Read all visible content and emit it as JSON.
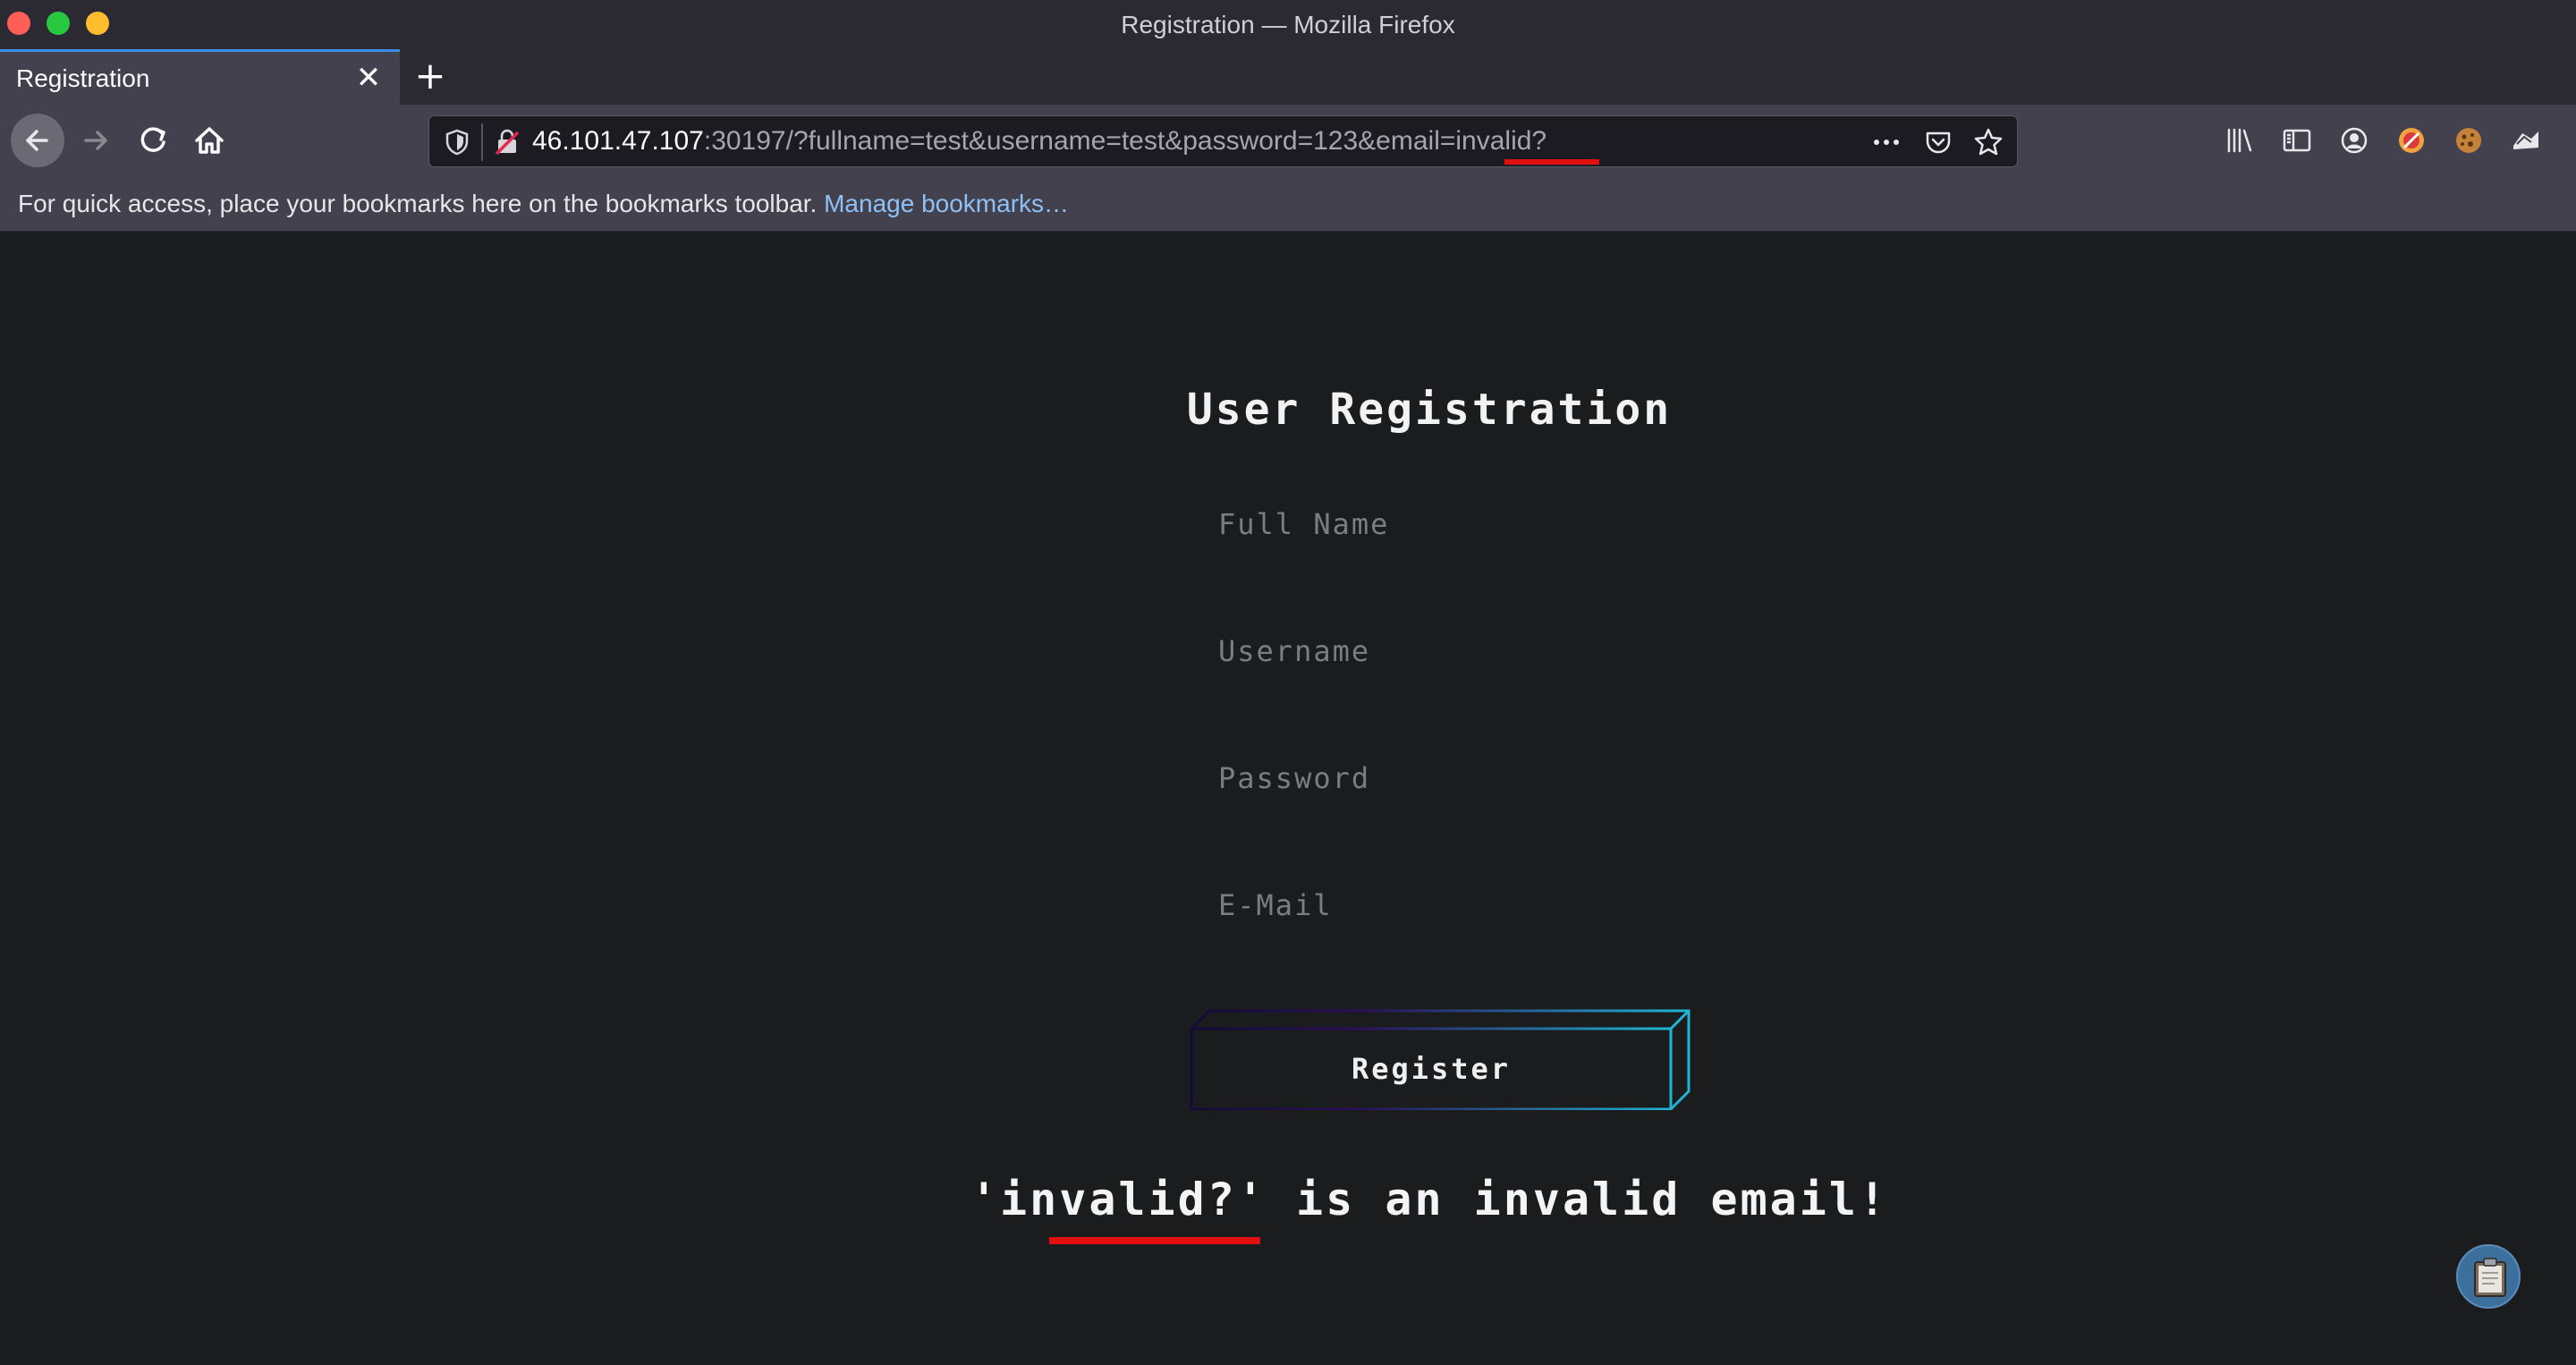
{
  "window": {
    "title": "Registration — Mozilla Firefox"
  },
  "tabs": [
    {
      "label": "Registration",
      "active": true
    }
  ],
  "urlbar": {
    "host": "46.101.47.107",
    "rest": ":30197/?fullname=test&username=test&password=123&email=invalid?"
  },
  "bookmarks_bar": {
    "message": "For quick access, place your bookmarks here on the bookmarks toolbar. ",
    "link_label": "Manage bookmarks…"
  },
  "page": {
    "title": "User Registration",
    "form": {
      "fullname_placeholder": "Full Name",
      "username_placeholder": "Username",
      "password_placeholder": "Password",
      "email_placeholder": "E-Mail",
      "register_label": "Register"
    },
    "error_message": "'invalid?' is an invalid email!"
  },
  "colors": {
    "page_bg": "#1b1c1e",
    "toolbar_bg": "#42414d",
    "highlight_underline": "#e20f0f",
    "button_gradient_start": "#1a0a3a",
    "button_gradient_end": "#1fb6d4",
    "link": "#8fc0f5"
  },
  "icons": [
    "back-arrow-icon",
    "forward-arrow-icon",
    "reload-icon",
    "home-icon",
    "shield-icon",
    "insecure-lock-icon",
    "more-actions-icon",
    "pocket-icon",
    "bookmark-star-icon",
    "library-icon",
    "sidebar-icon",
    "account-icon",
    "extension-icon",
    "clipboard-icon"
  ]
}
